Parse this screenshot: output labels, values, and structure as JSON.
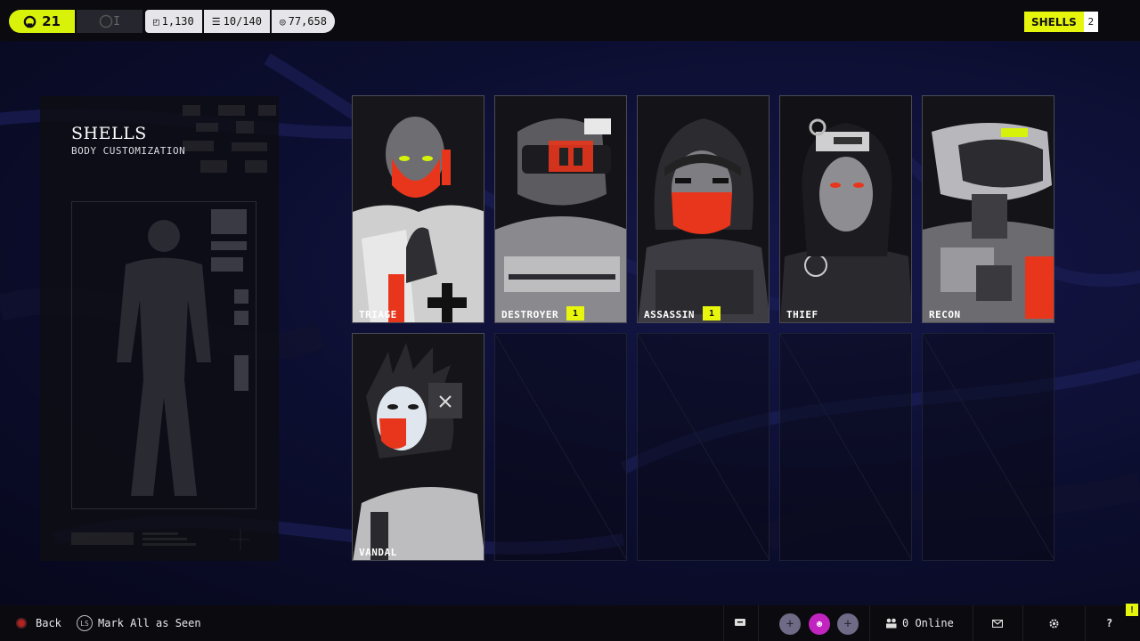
{
  "topbar": {
    "level": "21",
    "status_text": "I",
    "currencies": [
      {
        "icon": "box-icon",
        "value": "1,130"
      },
      {
        "icon": "list-icon",
        "value": "10/140"
      },
      {
        "icon": "coin-icon",
        "value": "77,658"
      }
    ],
    "badge_label": "SHELLS",
    "badge_count": "2"
  },
  "panel": {
    "title": "SHELLS",
    "subtitle": "BODY CUSTOMIZATION"
  },
  "shells": [
    {
      "name": "TRIAGE",
      "badge": ""
    },
    {
      "name": "DESTROYER",
      "badge": "1"
    },
    {
      "name": "ASSASSIN",
      "badge": "1"
    },
    {
      "name": "THIEF",
      "badge": ""
    },
    {
      "name": "RECON",
      "badge": ""
    },
    {
      "name": "VANDAL",
      "badge": ""
    }
  ],
  "bottombar": {
    "back_label": "Back",
    "mark_label": "Mark All as Seen",
    "online_label": "0 Online"
  },
  "colors": {
    "accent": "#e6f50c",
    "red": "#e8361c",
    "party": "#c224c0"
  }
}
